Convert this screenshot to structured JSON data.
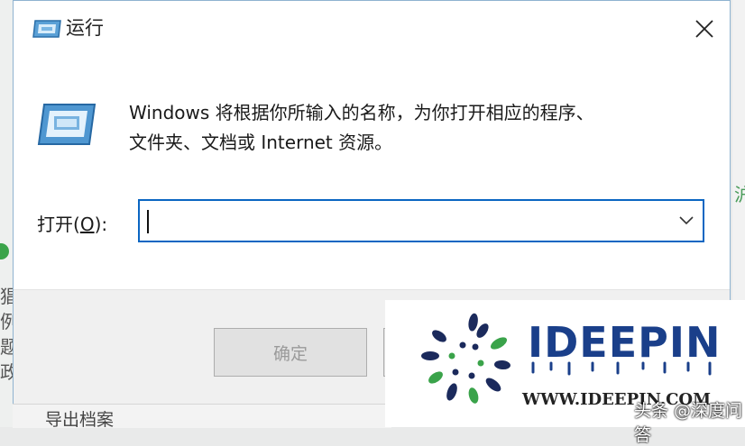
{
  "dialog": {
    "title": "运行",
    "description_line1": "Windows 将根据你所输入的名称，为你打开相应的程序、",
    "description_line2": "文件夹、文档或 Internet 资源。",
    "open_label_prefix": "打开(",
    "open_label_accel": "O",
    "open_label_suffix": "):",
    "open_value": "",
    "ok_label": "确定",
    "close_icon": "close-icon",
    "dropdown_icon": "chevron-down-icon",
    "run_icon": "run-window-icon"
  },
  "background": {
    "left_glyphs": [
      "猖",
      "例",
      "题",
      "政"
    ],
    "right_glyph": "沪",
    "bottom_text": "导出档案"
  },
  "watermark": {
    "brand": "IDEEPIN",
    "url": "WWW.IDEEPIN.COM",
    "tag": "头条 @深度问答"
  },
  "colors": {
    "focus_border": "#0a66c2",
    "brand_blue": "#1a3f8a",
    "logo_green": "#3aa34a",
    "logo_navy": "#1b2a5c"
  }
}
